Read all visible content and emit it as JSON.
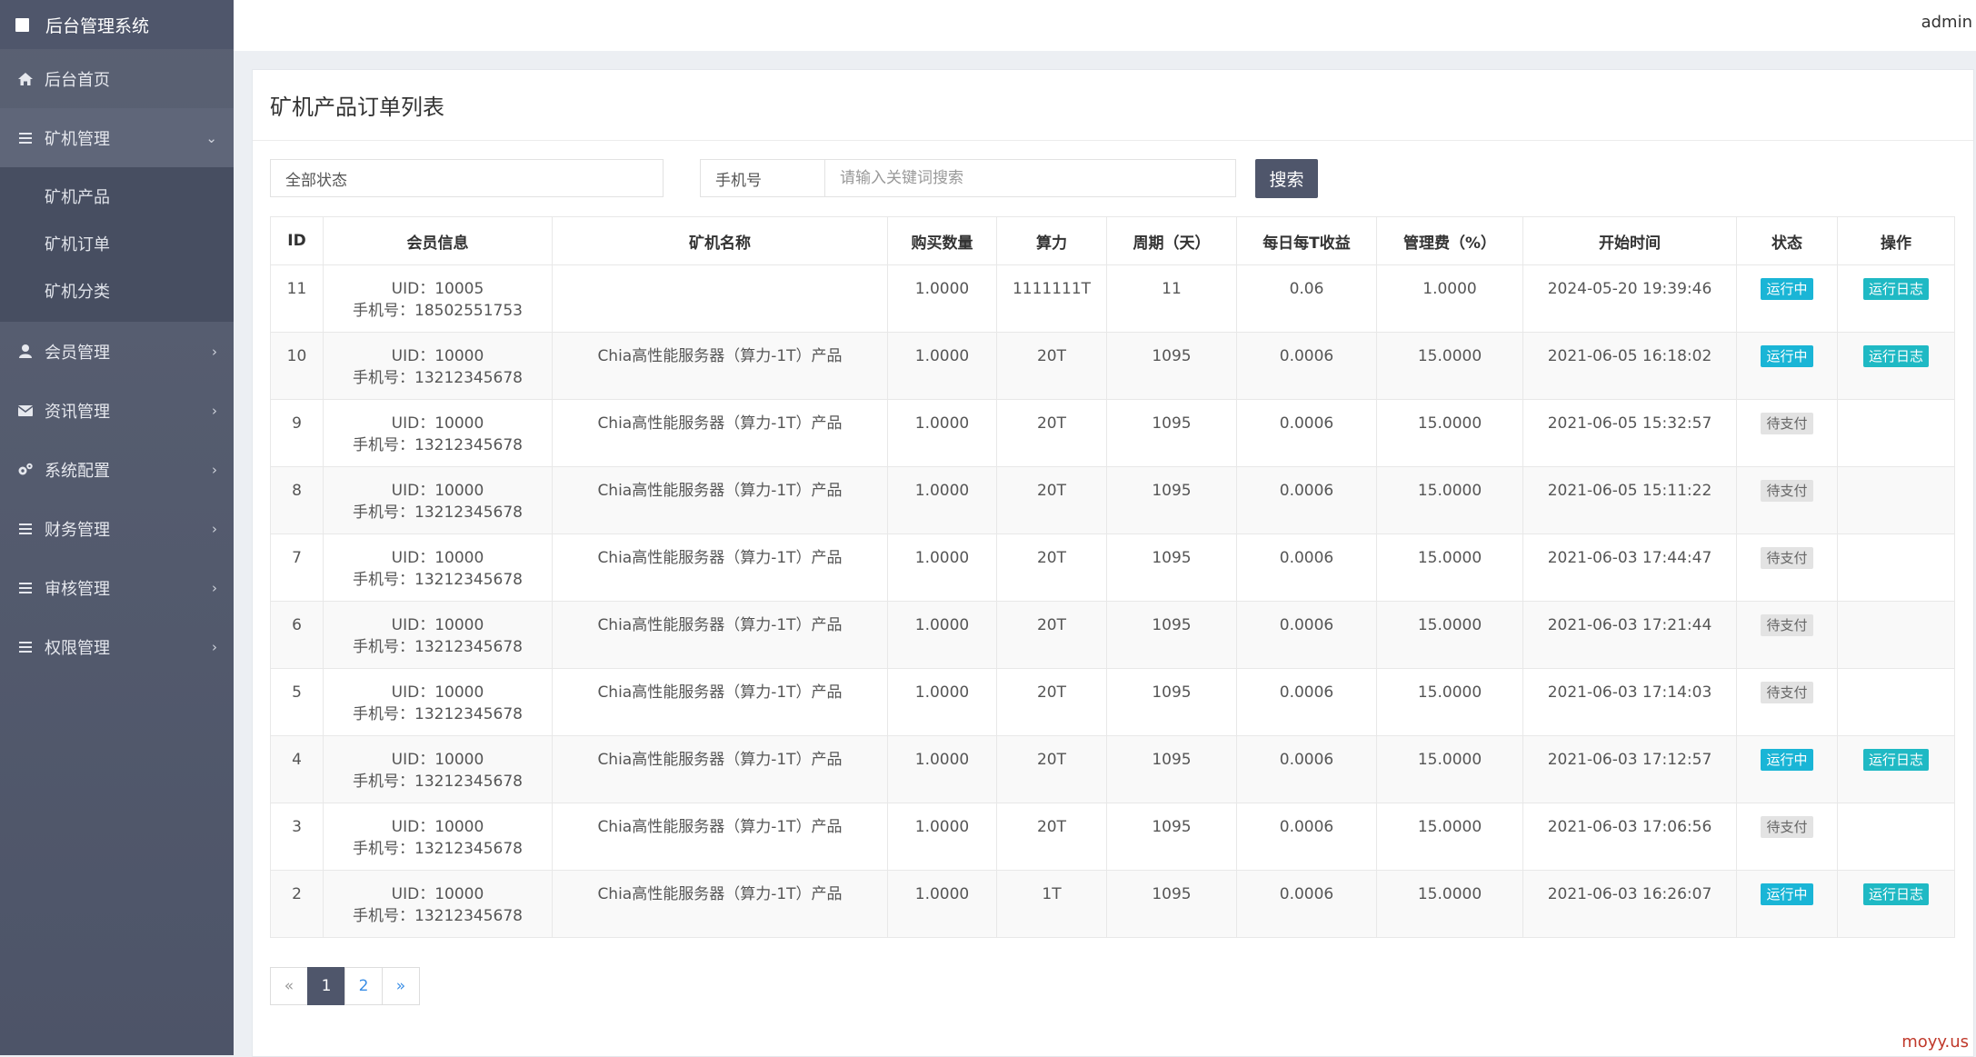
{
  "sidebar": {
    "brand": "后台管理系统",
    "items": [
      {
        "label": "后台首页"
      },
      {
        "label": "矿机管理"
      },
      {
        "label": "会员管理"
      },
      {
        "label": "资讯管理"
      },
      {
        "label": "系统配置"
      },
      {
        "label": "财务管理"
      },
      {
        "label": "审核管理"
      },
      {
        "label": "权限管理"
      }
    ],
    "subitems": [
      {
        "label": "矿机产品"
      },
      {
        "label": "矿机订单"
      },
      {
        "label": "矿机分类"
      }
    ]
  },
  "header": {
    "user": "admin"
  },
  "page": {
    "title": "矿机产品订单列表"
  },
  "filters": {
    "status_value": "全部状态",
    "phone_label": "手机号",
    "keyword_placeholder": "请输入关键词搜索",
    "search_label": "搜索"
  },
  "table": {
    "headers": [
      "ID",
      "会员信息",
      "矿机名称",
      "购买数量",
      "算力",
      "周期（天）",
      "每日每T收益",
      "管理费（%）",
      "开始时间",
      "状态",
      "操作"
    ],
    "rows": [
      {
        "id": "11",
        "uid": "UID：10005",
        "phone": "手机号：18502551753",
        "name": "",
        "qty": "1.0000",
        "power": "1111111T",
        "cycle": "11",
        "daily": "0.06",
        "fee": "1.0000",
        "start": "2024-05-20 19:39:46",
        "status": "运行中",
        "action": "运行日志"
      },
      {
        "id": "10",
        "uid": "UID：10000",
        "phone": "手机号：13212345678",
        "name": "Chia高性能服务器（算力-1T）产品",
        "qty": "1.0000",
        "power": "20T",
        "cycle": "1095",
        "daily": "0.0006",
        "fee": "15.0000",
        "start": "2021-06-05 16:18:02",
        "status": "运行中",
        "action": "运行日志"
      },
      {
        "id": "9",
        "uid": "UID：10000",
        "phone": "手机号：13212345678",
        "name": "Chia高性能服务器（算力-1T）产品",
        "qty": "1.0000",
        "power": "20T",
        "cycle": "1095",
        "daily": "0.0006",
        "fee": "15.0000",
        "start": "2021-06-05 15:32:57",
        "status": "待支付",
        "action": ""
      },
      {
        "id": "8",
        "uid": "UID：10000",
        "phone": "手机号：13212345678",
        "name": "Chia高性能服务器（算力-1T）产品",
        "qty": "1.0000",
        "power": "20T",
        "cycle": "1095",
        "daily": "0.0006",
        "fee": "15.0000",
        "start": "2021-06-05 15:11:22",
        "status": "待支付",
        "action": ""
      },
      {
        "id": "7",
        "uid": "UID：10000",
        "phone": "手机号：13212345678",
        "name": "Chia高性能服务器（算力-1T）产品",
        "qty": "1.0000",
        "power": "20T",
        "cycle": "1095",
        "daily": "0.0006",
        "fee": "15.0000",
        "start": "2021-06-03 17:44:47",
        "status": "待支付",
        "action": ""
      },
      {
        "id": "6",
        "uid": "UID：10000",
        "phone": "手机号：13212345678",
        "name": "Chia高性能服务器（算力-1T）产品",
        "qty": "1.0000",
        "power": "20T",
        "cycle": "1095",
        "daily": "0.0006",
        "fee": "15.0000",
        "start": "2021-06-03 17:21:44",
        "status": "待支付",
        "action": ""
      },
      {
        "id": "5",
        "uid": "UID：10000",
        "phone": "手机号：13212345678",
        "name": "Chia高性能服务器（算力-1T）产品",
        "qty": "1.0000",
        "power": "20T",
        "cycle": "1095",
        "daily": "0.0006",
        "fee": "15.0000",
        "start": "2021-06-03 17:14:03",
        "status": "待支付",
        "action": ""
      },
      {
        "id": "4",
        "uid": "UID：10000",
        "phone": "手机号：13212345678",
        "name": "Chia高性能服务器（算力-1T）产品",
        "qty": "1.0000",
        "power": "20T",
        "cycle": "1095",
        "daily": "0.0006",
        "fee": "15.0000",
        "start": "2021-06-03 17:12:57",
        "status": "运行中",
        "action": "运行日志"
      },
      {
        "id": "3",
        "uid": "UID：10000",
        "phone": "手机号：13212345678",
        "name": "Chia高性能服务器（算力-1T）产品",
        "qty": "1.0000",
        "power": "20T",
        "cycle": "1095",
        "daily": "0.0006",
        "fee": "15.0000",
        "start": "2021-06-03 17:06:56",
        "status": "待支付",
        "action": ""
      },
      {
        "id": "2",
        "uid": "UID：10000",
        "phone": "手机号：13212345678",
        "name": "Chia高性能服务器（算力-1T）产品",
        "qty": "1.0000",
        "power": "1T",
        "cycle": "1095",
        "daily": "0.0006",
        "fee": "15.0000",
        "start": "2021-06-03 16:26:07",
        "status": "运行中",
        "action": "运行日志"
      }
    ]
  },
  "pagination": {
    "prev": "«",
    "pages": [
      "1",
      "2"
    ],
    "next": "»"
  },
  "watermark": "moyy.us",
  "colors": {
    "sidebar": "#545b6e",
    "accent": "#4f566b",
    "running": "#1ab5d6",
    "log": "#1fb9c4"
  }
}
